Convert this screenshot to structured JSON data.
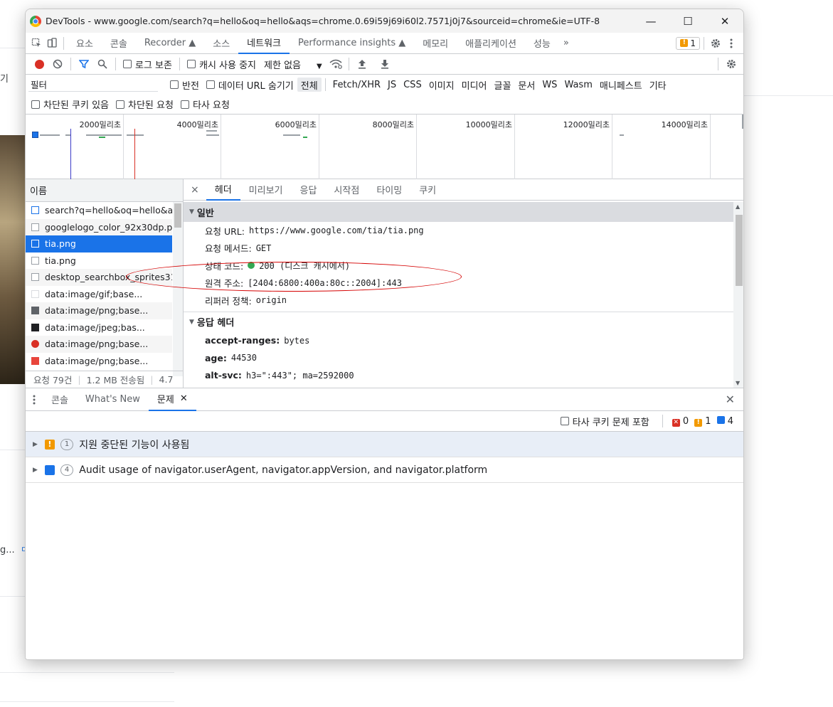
{
  "background": {
    "left_texts": [
      "기",
      "g...",
      "ㅁ"
    ]
  },
  "window": {
    "title": "DevTools - www.google.com/search?q=hello&oq=hello&aqs=chrome.0.69i59j69i60l2.7571j0j7&sourceid=chrome&ie=UTF-8",
    "minimize": "—",
    "maximize": "☐",
    "close": "✕"
  },
  "tabs": [
    "요소",
    "콘솔",
    "Recorder ▲",
    "소스",
    "네트워크",
    "Performance insights ▲",
    "메모리",
    "애플리케이션",
    "성능"
  ],
  "active_tab": "네트워크",
  "more_tabs": "»",
  "issues_badge": {
    "count": "1"
  },
  "toolbar": {
    "preserve_log": "로그 보존",
    "disable_cache": "캐시 사용 중지",
    "throttle": "제한 없음"
  },
  "filter": {
    "placeholder": "필터",
    "value": "필터",
    "invert": "반전",
    "hide_data_urls": "데이터 URL 숨기기",
    "types": [
      "전체",
      "Fetch/XHR",
      "JS",
      "CSS",
      "이미지",
      "미디어",
      "글꼴",
      "문서",
      "WS",
      "Wasm",
      "매니페스트",
      "기타"
    ],
    "selected_type": "전체"
  },
  "filter2": {
    "blocked_cookies": "차단된 쿠키 있음",
    "blocked_requests": "차단된 요청",
    "third_party": "타사 요청"
  },
  "overview": {
    "labels": [
      "2000밀리초",
      "4000밀리초",
      "6000밀리초",
      "8000밀리초",
      "10000밀리초",
      "12000밀리초",
      "14000밀리초"
    ]
  },
  "requests": {
    "header": "이름",
    "items": [
      "search?q=hello&oq=hello&a",
      "googlelogo_color_92x30dp.p",
      "tia.png",
      "tia.png",
      "desktop_searchbox_sprites31",
      "data:image/gif;base...",
      "data:image/png;base...",
      "data:image/jpeg;bas...",
      "data:image/png;base...",
      "data:image/png;base..."
    ],
    "selected_index": 2
  },
  "summary": {
    "requests": "요청 79건",
    "transferred": "1.2 MB 전송됨",
    "resources": "4.7"
  },
  "detail": {
    "close": "×",
    "tabs": [
      "헤더",
      "미리보기",
      "응답",
      "시작점",
      "타이밍",
      "쿠키"
    ],
    "active_tab": "헤더",
    "general": {
      "title": "일반",
      "rows": [
        {
          "key": "요청 URL:",
          "value": "https://www.google.com/tia/tia.png"
        },
        {
          "key": "요청 메서드:",
          "value": "GET"
        },
        {
          "key": "상태 코드:",
          "value": "200  (디스크 캐시에서)"
        },
        {
          "key": "원격 주소:",
          "value": "[2404:6800:400a:80c::2004]:443"
        },
        {
          "key": "리퍼러 정책:",
          "value": "origin"
        }
      ]
    },
    "response_headers": {
      "title": "응답 헤더",
      "rows": [
        {
          "key": "accept-ranges:",
          "value": "bytes"
        },
        {
          "key": "age:",
          "value": "44530"
        },
        {
          "key": "alt-svc:",
          "value": "h3=\":443\"; ma=2592000"
        }
      ]
    }
  },
  "drawer": {
    "tabs": [
      "콘솔",
      "What's New",
      "문제"
    ],
    "active_tab": "문제",
    "third_party_cookie": "타사 쿠키 문제 포함",
    "counts": {
      "errors": "0",
      "warnings": "1",
      "info": "4"
    },
    "issues": [
      {
        "count": "1",
        "text": "지원 중단된 기능이 사용됨",
        "kind": "warning"
      },
      {
        "count": "4",
        "text": "Audit usage of navigator.userAgent, navigator.appVersion, and navigator.platform",
        "kind": "info"
      }
    ]
  },
  "colors": {
    "accent": "#1a73e8",
    "record": "#d93025",
    "warning": "#f29900",
    "annotation": "#d50000",
    "status_ok": "#34a853"
  }
}
